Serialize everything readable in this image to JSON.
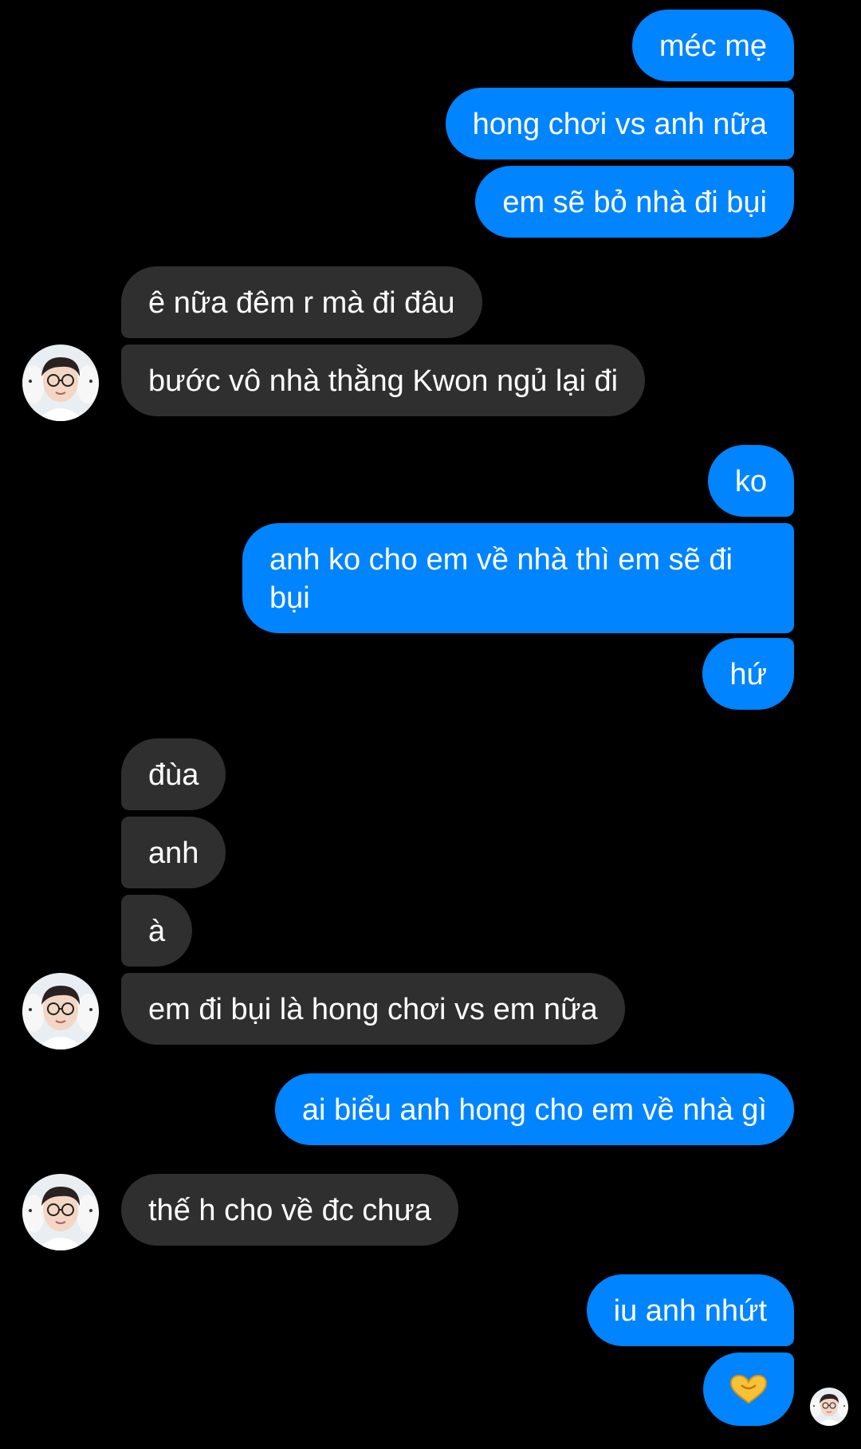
{
  "colors": {
    "background": "#000000",
    "outgoing_bubble": "#0084ff",
    "incoming_bubble": "#2f2f2f",
    "text": "#ffffff"
  },
  "messages": [
    {
      "id": "m1",
      "direction": "outgoing",
      "text": "méc mẹ"
    },
    {
      "id": "m2",
      "direction": "outgoing",
      "text": "hong chơi vs anh nữa"
    },
    {
      "id": "m3",
      "direction": "outgoing",
      "text": "em sẽ bỏ nhà đi bụi"
    },
    {
      "id": "m4",
      "direction": "incoming",
      "text": "ê nữa đêm r mà đi đâu"
    },
    {
      "id": "m5",
      "direction": "incoming",
      "text": "bước vô nhà thằng Kwon ngủ lại đi"
    },
    {
      "id": "m6",
      "direction": "outgoing",
      "text": "ko"
    },
    {
      "id": "m7",
      "direction": "outgoing",
      "text": "anh ko cho em về nhà thì em sẽ đi bụi"
    },
    {
      "id": "m8",
      "direction": "outgoing",
      "text": "hứ"
    },
    {
      "id": "m9",
      "direction": "incoming",
      "text": "đùa"
    },
    {
      "id": "m10",
      "direction": "incoming",
      "text": "anh"
    },
    {
      "id": "m11",
      "direction": "incoming",
      "text": "à"
    },
    {
      "id": "m12",
      "direction": "incoming",
      "text": "em đi bụi là hong chơi vs em nữa"
    },
    {
      "id": "m13",
      "direction": "outgoing",
      "text": "ai biểu anh hong cho em về nhà gì"
    },
    {
      "id": "m14",
      "direction": "incoming",
      "text": "thế h cho về đc chưa"
    },
    {
      "id": "m15",
      "direction": "outgoing",
      "text": "iu anh nhứt"
    },
    {
      "id": "m16",
      "direction": "outgoing",
      "icon": "yellow-heart-hands-emoji"
    }
  ],
  "avatars": [
    {
      "id": "a1",
      "icon": "contact-avatar"
    },
    {
      "id": "a2",
      "icon": "contact-avatar"
    },
    {
      "id": "a3",
      "icon": "contact-avatar"
    }
  ],
  "seen_indicator": {
    "icon": "seen-avatar"
  }
}
